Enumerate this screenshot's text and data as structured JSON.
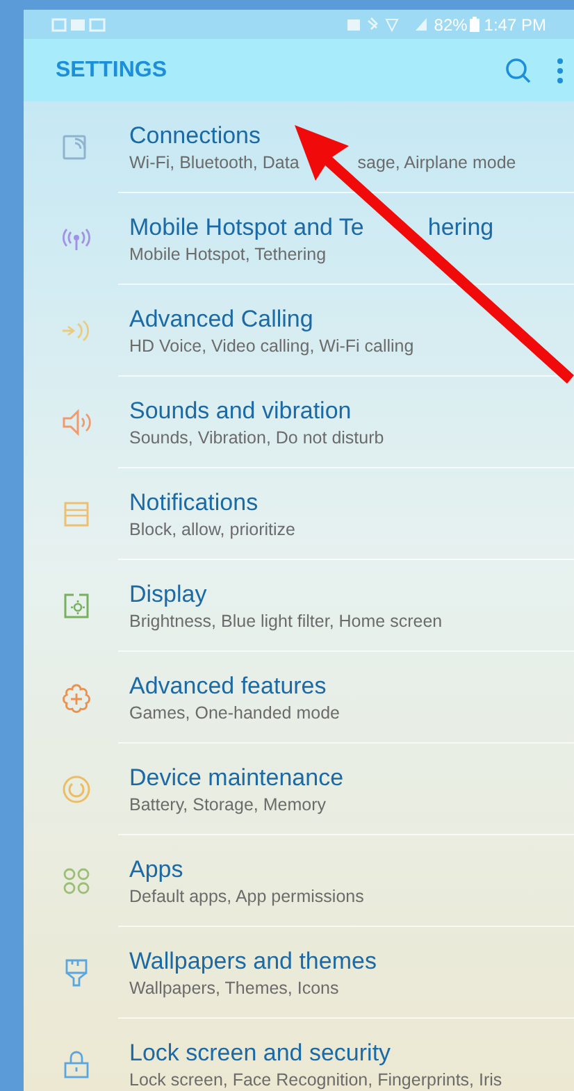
{
  "status_bar": {
    "battery": "82%",
    "time": "1:47 PM"
  },
  "header": {
    "title": "SETTINGS"
  },
  "items": [
    {
      "title": "Connections",
      "subtitle": [
        "Wi-Fi, Bluetooth, Data",
        "sage, Airplane mode"
      ]
    },
    {
      "title": [
        "Mobile Hotspot and Te",
        "hering"
      ],
      "subtitle": "Mobile Hotspot, Tethering"
    },
    {
      "title": "Advanced Calling",
      "subtitle": "HD Voice, Video calling, Wi-Fi calling"
    },
    {
      "title": "Sounds and vibration",
      "subtitle": "Sounds, Vibration, Do not disturb"
    },
    {
      "title": "Notifications",
      "subtitle": "Block, allow, prioritize"
    },
    {
      "title": "Display",
      "subtitle": "Brightness, Blue light filter, Home screen"
    },
    {
      "title": "Advanced features",
      "subtitle": "Games, One-handed mode"
    },
    {
      "title": "Device maintenance",
      "subtitle": "Battery, Storage, Memory"
    },
    {
      "title": "Apps",
      "subtitle": "Default apps, App permissions"
    },
    {
      "title": "Wallpapers and themes",
      "subtitle": "Wallpapers, Themes, Icons"
    },
    {
      "title": "Lock screen and security",
      "subtitle": "Lock screen, Face Recognition, Fingerprints, Iris"
    }
  ]
}
